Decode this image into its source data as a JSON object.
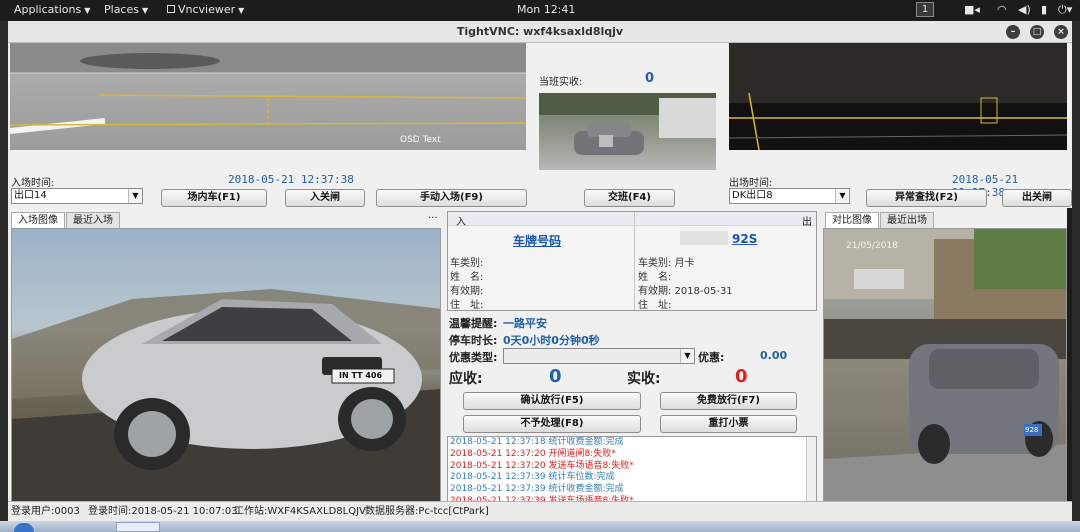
{
  "topbar": {
    "applications": "Applications",
    "places": "Places",
    "vncviewer": "Vncviewer",
    "clock": "Mon 12:41",
    "workspace": "1"
  },
  "window": {
    "title": "TightVNC: wxf4ksaxld8lqjv"
  },
  "center_top": {
    "label": "当班实收:",
    "value": "0"
  },
  "overlay_text": "OSD Text",
  "entry": {
    "time_label": "入场时间:",
    "time_value": "2018-05-21 12:37:38",
    "gate_select": "出口14",
    "btn_inner_car": "场内车(F1)",
    "btn_open_gate": "入关闸",
    "btn_manual_entry": "手动入场(F9)",
    "tab_image": "入场图像",
    "tab_recent": "最近入场",
    "more": "...",
    "plate_overlay": "IN TT 406"
  },
  "center": {
    "btn_handover": "交班(F4)",
    "in_label": "入",
    "out_label": "出",
    "in_plate": "车牌号码",
    "out_plate": "92S",
    "fields_left": [
      "车类别:",
      "姓　名:",
      "有效期:",
      "住　址:"
    ],
    "fields_right": [
      "车类别: 月卡",
      "姓　名:",
      "有效期: 2018-05-31",
      "住　址:"
    ],
    "tip_label": "温馨提醒:",
    "tip_value": "一路平安",
    "duration_label": "停车时长:",
    "duration_value": "0天0小时0分钟0秒",
    "discount_type_label": "优惠类型:",
    "discount_label": "优惠:",
    "discount_value": "0.00",
    "receivable_label": "应收:",
    "receivable_value": "0",
    "received_label": "实收:",
    "received_value": "0",
    "btn_confirm": "确认放行(F5)",
    "btn_free": "免费放行(F7)",
    "btn_reject": "不予处理(F8)",
    "btn_reprint": "重打小票"
  },
  "log": [
    {
      "text": "2018-05-21 12:37:18 统计收费金额:完成",
      "color": "#2f7fb8"
    },
    {
      "text": "2018-05-21 12:37:20 开闸道闸8:失败*",
      "color": "#e0201e"
    },
    {
      "text": "2018-05-21 12:37:20 发送车场语音8:失败*",
      "color": "#e0201e"
    },
    {
      "text": "2018-05-21 12:37:39 统计车位数:完成",
      "color": "#2f7fb8"
    },
    {
      "text": "2018-05-21 12:37:39 统计收费金额:完成",
      "color": "#2f7fb8"
    },
    {
      "text": "2018-05-21 12:37:39 发送车场语音8:失败*",
      "color": "#e0201e"
    }
  ],
  "exit": {
    "time_label": "出场时间:",
    "time_value": "2018-05-21 12:37:38",
    "gate_select": "DK出口8",
    "btn_abnormal": "异常查找(F2)",
    "btn_close_gate": "出关闸",
    "tab_compare": "对比图像",
    "tab_recent": "最近出场",
    "cam_stamp": "21/05/2018",
    "plate_small": "928"
  },
  "status": {
    "user": "登录用户:0003",
    "login_time": "登录时间:2018-05-21 10:07:03",
    "workstation": "工作站:WXF4KSAXLD8LQJV",
    "db_server": "数据服务器:Pc-tcc[CtPark]"
  },
  "colors": {
    "accent_blue": "#1f5fa8",
    "red": "#e0201e",
    "plate_link": "#1a56b0"
  }
}
